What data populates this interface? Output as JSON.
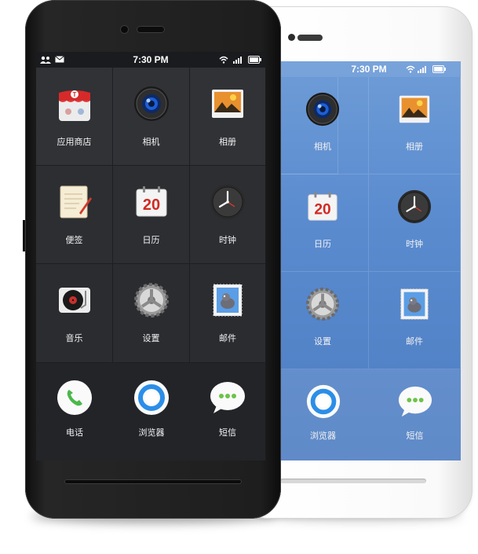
{
  "status_bar": {
    "time": "7:30 PM"
  },
  "black_phone": {
    "apps": [
      {
        "label": "应用商店",
        "icon": "app-store-icon"
      },
      {
        "label": "相机",
        "icon": "camera-icon"
      },
      {
        "label": "相册",
        "icon": "gallery-icon"
      },
      {
        "label": "便签",
        "icon": "notes-icon"
      },
      {
        "label": "日历",
        "icon": "calendar-icon"
      },
      {
        "label": "时钟",
        "icon": "clock-icon"
      },
      {
        "label": "音乐",
        "icon": "music-icon"
      },
      {
        "label": "设置",
        "icon": "settings-icon"
      },
      {
        "label": "邮件",
        "icon": "mail-icon"
      }
    ],
    "dock": [
      {
        "label": "电话",
        "icon": "phone-icon"
      },
      {
        "label": "浏览器",
        "icon": "browser-icon"
      },
      {
        "label": "短信",
        "icon": "sms-icon"
      }
    ]
  },
  "white_phone": {
    "apps": [
      {
        "label": "相机",
        "icon": "camera-icon"
      },
      {
        "label": "相册",
        "icon": "gallery-icon"
      },
      {
        "label": "日历",
        "icon": "calendar-icon"
      },
      {
        "label": "时钟",
        "icon": "clock-icon"
      },
      {
        "label": "设置",
        "icon": "settings-icon"
      },
      {
        "label": "邮件",
        "icon": "mail-icon"
      }
    ],
    "dock": [
      {
        "label": "浏览器",
        "icon": "browser-icon"
      },
      {
        "label": "短信",
        "icon": "sms-icon"
      }
    ]
  },
  "calendar_day": "20",
  "colors": {
    "black_body": "#1e1e1e",
    "white_screen": "#5a8bcf",
    "accent_red": "#d12a22"
  }
}
